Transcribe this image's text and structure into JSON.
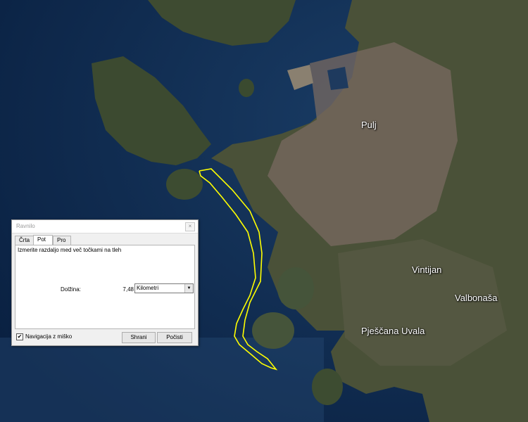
{
  "map": {
    "labels": {
      "pulj": "Pulj",
      "vintijan": "Vintijan",
      "valbonasa": "Valbonaša",
      "pjescana": "Pješčana Uvala"
    },
    "path_color": "#ffff00",
    "water_color": "#0d2a4e",
    "land_color": "#3b4a2d"
  },
  "ruler": {
    "title": "Ravnilo",
    "close_glyph": "×",
    "tabs": [
      "Črta",
      "Pot",
      "Pro"
    ],
    "active_tab": "Pot",
    "instructions": "Izmerite razdaljo med več točkami na tleh",
    "length_label": "Dolžina:",
    "length_value": "7,48",
    "units": "Kilometri",
    "nav_checkbox_label": "Navigacija z miško",
    "nav_checked": true,
    "save_label": "Shrani",
    "clear_label": "Počisti"
  }
}
